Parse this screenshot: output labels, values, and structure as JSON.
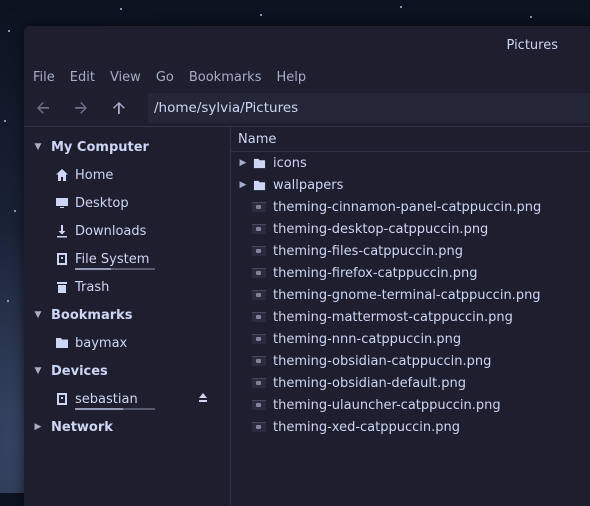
{
  "window": {
    "title": "Pictures"
  },
  "menu": [
    "File",
    "Edit",
    "View",
    "Go",
    "Bookmarks",
    "Help"
  ],
  "toolbar": {
    "path": "/home/sylvia/Pictures"
  },
  "sidebar": {
    "sections": [
      {
        "label": "My Computer",
        "expanded": true,
        "items": [
          {
            "label": "Home",
            "icon": "home-icon"
          },
          {
            "label": "Desktop",
            "icon": "desktop-icon"
          },
          {
            "label": "Downloads",
            "icon": "download-icon"
          },
          {
            "label": "File System",
            "icon": "drive-icon",
            "usage": 0.45
          },
          {
            "label": "Trash",
            "icon": "trash-icon"
          }
        ]
      },
      {
        "label": "Bookmarks",
        "expanded": true,
        "items": [
          {
            "label": "baymax",
            "icon": "folder-icon"
          }
        ]
      },
      {
        "label": "Devices",
        "expanded": true,
        "items": [
          {
            "label": "sebastian",
            "icon": "drive-icon",
            "usage": 0.6,
            "eject": true
          }
        ]
      },
      {
        "label": "Network",
        "expanded": false,
        "items": []
      }
    ]
  },
  "list": {
    "column": "Name",
    "rows": [
      {
        "name": "icons",
        "type": "folder"
      },
      {
        "name": "wallpapers",
        "type": "folder"
      },
      {
        "name": "theming-cinnamon-panel-catppuccin.png",
        "type": "image"
      },
      {
        "name": "theming-desktop-catppuccin.png",
        "type": "image"
      },
      {
        "name": "theming-files-catppuccin.png",
        "type": "image"
      },
      {
        "name": "theming-firefox-catppuccin.png",
        "type": "image"
      },
      {
        "name": "theming-gnome-terminal-catppuccin.png",
        "type": "image"
      },
      {
        "name": "theming-mattermost-catppuccin.png",
        "type": "image"
      },
      {
        "name": "theming-nnn-catppuccin.png",
        "type": "image"
      },
      {
        "name": "theming-obsidian-catppuccin.png",
        "type": "image"
      },
      {
        "name": "theming-obsidian-default.png",
        "type": "image"
      },
      {
        "name": "theming-ulauncher-catppuccin.png",
        "type": "image"
      },
      {
        "name": "theming-xed-catppuccin.png",
        "type": "image"
      }
    ]
  },
  "colors": {
    "window_bg": "#1e1e2e",
    "text": "#cdd6f4",
    "border": "#313244"
  }
}
